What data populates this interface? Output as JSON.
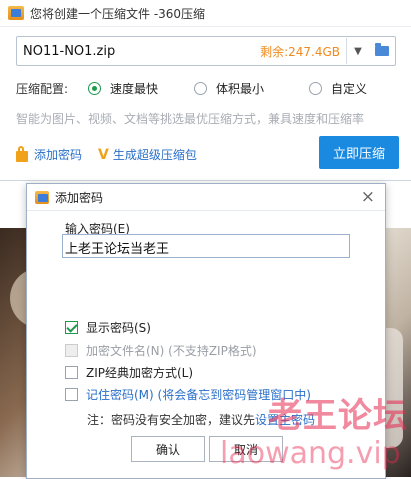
{
  "window": {
    "title": "您将创建一个压缩文件 -360压缩",
    "path_value": "NO11-NO1.zip",
    "space_left": "剩余:247.4GB",
    "config_label": "压缩配置:",
    "options": [
      "速度最快",
      "体积最小",
      "自定义"
    ],
    "selected_option": "速度最快",
    "hint": "智能为图片、视频、文档等挑选最优压缩方式，兼具速度和压缩率",
    "add_password_link": "添加密码",
    "super_package_link": "生成超级压缩包",
    "compress_button": "立即压缩"
  },
  "dialog": {
    "title": "添加密码",
    "input_label": "输入密码(E)",
    "password_value": "上老王论坛当老王",
    "checkboxes": [
      {
        "label": "显示密码(S)",
        "checked": true,
        "disabled": false
      },
      {
        "label": "加密文件名(N) (不支持ZIP格式)",
        "checked": false,
        "disabled": true
      },
      {
        "label": "ZIP经典加密方式(L)",
        "checked": false,
        "disabled": false
      },
      {
        "label": "记住密码(M) (将会备忘到密码管理窗口中)",
        "checked": false,
        "disabled": false
      }
    ],
    "note_prefix": "注：密码没有安全加密，建议先",
    "note_link": "设置主密码",
    "ok_button": "确认",
    "cancel_button": "取消"
  },
  "watermark": {
    "line1": "老王论坛",
    "line2": "laowang.vip"
  },
  "colors": {
    "accent_blue": "#1a89e0",
    "link_blue": "#2a6fc9",
    "orange": "#f08a1c",
    "green": "#1d9b4a"
  }
}
